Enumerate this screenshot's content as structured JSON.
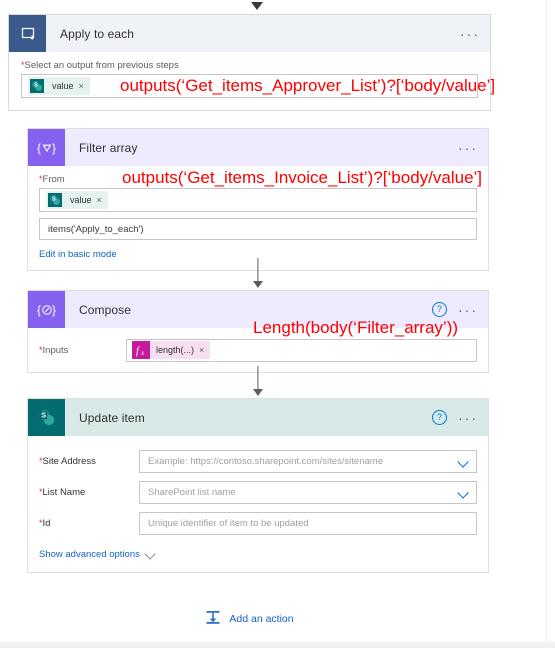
{
  "flow": {
    "loop": {
      "icon": "apply-to-each-loop-icon",
      "title": "Apply to each",
      "more_label": "···",
      "field_label": "Select an output from previous steps",
      "required_marker": "*",
      "token": {
        "icon": "sharepoint-icon",
        "text": "value",
        "remove": "×"
      },
      "annotation": "outputs(‘Get_items_Approver_List’)?[‘body/value’]"
    },
    "filter": {
      "icon": "filter-array-icon",
      "icon_glyph": "{∇}",
      "title": "Filter array",
      "more_label": "···",
      "from_label": "From",
      "required_marker": "*",
      "token": {
        "icon": "sharepoint-icon",
        "text": "value",
        "remove": "×"
      },
      "annotation": "outputs(‘Get_items_Invoice_List’)?[‘body/value’]",
      "expression_value": "items('Apply_to_each')",
      "basic_mode_link": "Edit in basic mode"
    },
    "compose": {
      "icon": "compose-icon",
      "icon_glyph": "{✎}",
      "title": "Compose",
      "help_label": "?",
      "more_label": "···",
      "inputs_label": "Inputs",
      "required_marker": "*",
      "token": {
        "icon": "function-fx-icon",
        "icon_text": "fx",
        "text": "length(...)",
        "remove": "×"
      },
      "annotation": "Length(body(‘Filter_array’))"
    },
    "update": {
      "icon": "sharepoint-icon",
      "title": "Update item",
      "help_label": "?",
      "more_label": "···",
      "required_marker": "*",
      "fields": [
        {
          "label": "Site Address",
          "placeholder": "Example: https://contoso.sharepoint.com/sites/sitename",
          "has_chevron": true
        },
        {
          "label": "List Name",
          "placeholder": "SharePoint list name",
          "has_chevron": true
        },
        {
          "label": "Id",
          "placeholder": "Unique identifier of item to be updated",
          "has_chevron": false
        }
      ],
      "advanced_link": "Show advanced options"
    },
    "add_action": {
      "icon": "add-action-icon",
      "label": "Add an action"
    }
  },
  "colors": {
    "loop_accent": "#3a5a8c",
    "control_accent": "#8661f0",
    "sharepoint_accent": "#036c70",
    "function_accent": "#c5199e",
    "annotation": "#ff0000",
    "link": "#0f62c9"
  }
}
